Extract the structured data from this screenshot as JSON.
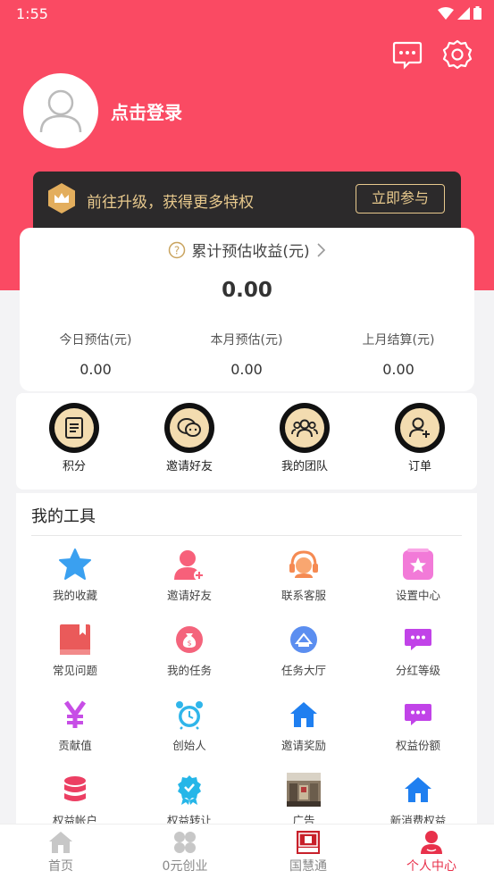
{
  "status_bar": {
    "time": "1:55"
  },
  "profile": {
    "login_text": "点击登录"
  },
  "vip": {
    "text": "前往升级，获得更多特权",
    "button": "立即参与"
  },
  "earnings": {
    "title": "累计预估收益(元)",
    "total": "0.00",
    "columns": [
      {
        "label": "今日预估(元)",
        "value": "0.00"
      },
      {
        "label": "本月预估(元)",
        "value": "0.00"
      },
      {
        "label": "上月结算(元)",
        "value": "0.00"
      }
    ]
  },
  "quick_actions": [
    {
      "label": "积分",
      "icon": "document-icon"
    },
    {
      "label": "邀请好友",
      "icon": "chat-icon"
    },
    {
      "label": "我的团队",
      "icon": "team-icon"
    },
    {
      "label": "订单",
      "icon": "user-add-icon"
    }
  ],
  "tools": {
    "title": "我的工具",
    "items": [
      {
        "label": "我的收藏",
        "icon": "star-icon"
      },
      {
        "label": "邀请好友",
        "icon": "user-add-icon"
      },
      {
        "label": "联系客服",
        "icon": "headset-icon"
      },
      {
        "label": "设置中心",
        "icon": "settings-star-icon"
      },
      {
        "label": "常见问题",
        "icon": "book-icon"
      },
      {
        "label": "我的任务",
        "icon": "moneybag-icon"
      },
      {
        "label": "任务大厅",
        "icon": "hall-icon"
      },
      {
        "label": "分红等级",
        "icon": "chat-bubble-icon"
      },
      {
        "label": "贡献值",
        "icon": "yen-icon"
      },
      {
        "label": "创始人",
        "icon": "alarm-clock-icon"
      },
      {
        "label": "邀请奖励",
        "icon": "home-icon"
      },
      {
        "label": "权益份额",
        "icon": "chat-bubble-icon"
      },
      {
        "label": "权益帐户",
        "icon": "database-icon"
      },
      {
        "label": "权益转让",
        "icon": "badge-icon"
      },
      {
        "label": "广告",
        "icon": "photo-icon"
      },
      {
        "label": "新消费权益",
        "icon": "home-icon"
      }
    ]
  },
  "bottom_nav": [
    {
      "label": "首页",
      "icon": "home-icon",
      "active": false
    },
    {
      "label": "0元创业",
      "icon": "grid-icon",
      "active": false
    },
    {
      "label": "国慧通",
      "icon": "brand-icon",
      "active": false
    },
    {
      "label": "个人中心",
      "icon": "person-icon",
      "active": true
    }
  ],
  "colors": {
    "brand": "#fa4a63",
    "gold": "#e8c98d",
    "active_nav": "#e8314b"
  }
}
